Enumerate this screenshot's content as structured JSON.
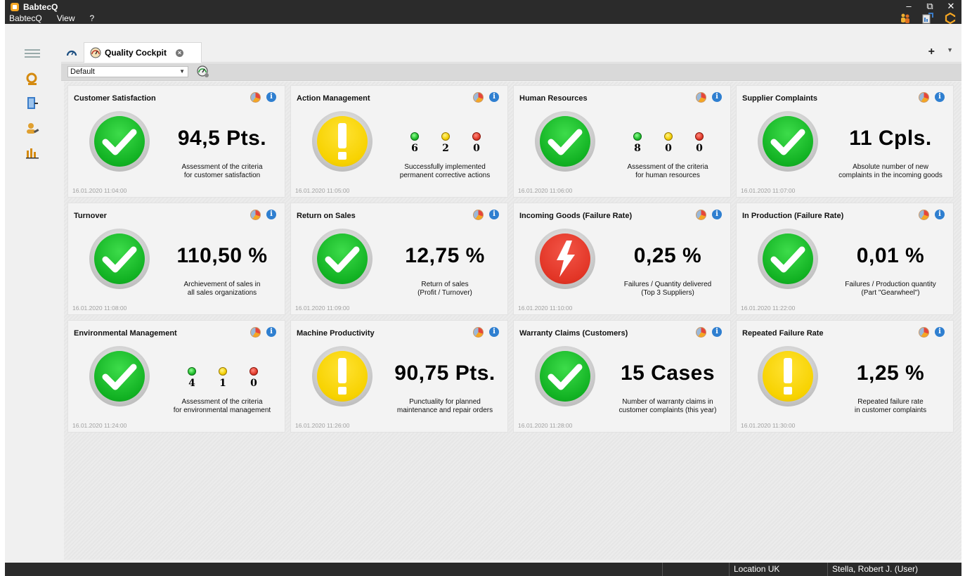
{
  "app": {
    "title": "BabtecQ"
  },
  "menu": [
    {
      "label": "BabtecQ"
    },
    {
      "label": "View"
    },
    {
      "label": "?"
    }
  ],
  "window_controls": {
    "minimize": "–",
    "restore": "⧉",
    "close": "✕"
  },
  "tabs": {
    "active_label": "Quality Cockpit"
  },
  "toolbar": {
    "select_value": "Default"
  },
  "tiles": [
    {
      "title": "Customer Satisfaction",
      "status": "ok",
      "kpi": "94,5 Pts.",
      "desc": [
        "Assessment of the criteria",
        "for customer satisfaction"
      ],
      "timestamp": "16.01.2020 11:04:00"
    },
    {
      "title": "Action Management",
      "status": "warn",
      "lights": [
        6,
        2,
        0
      ],
      "desc": [
        "Successfully implemented",
        "permanent corrective actions"
      ],
      "timestamp": "16.01.2020 11:05:00"
    },
    {
      "title": "Human Resources",
      "status": "ok",
      "lights": [
        8,
        0,
        0
      ],
      "desc": [
        "Assessment of the criteria",
        "for human resources"
      ],
      "timestamp": "16.01.2020 11:06:00"
    },
    {
      "title": "Supplier Complaints",
      "status": "ok",
      "kpi": "11 Cpls.",
      "desc": [
        "Absolute number of new",
        "complaints in the incoming goods"
      ],
      "timestamp": "16.01.2020 11:07:00"
    },
    {
      "title": "Turnover",
      "status": "ok",
      "kpi": "110,50 %",
      "desc": [
        "Archievement of sales in",
        "all sales organizations"
      ],
      "timestamp": "16.01.2020 11:08:00"
    },
    {
      "title": "Return on Sales",
      "status": "ok",
      "kpi": "12,75 %",
      "desc": [
        "Return of sales",
        "(Profit / Turnover)"
      ],
      "timestamp": "16.01.2020 11:09:00"
    },
    {
      "title": "Incoming Goods (Failure Rate)",
      "status": "error",
      "kpi": "0,25 %",
      "desc": [
        "Failures / Quantity delivered",
        "(Top 3 Suppliers)"
      ],
      "timestamp": "16.01.2020 11:10:00"
    },
    {
      "title": "In Production (Failure Rate)",
      "status": "ok",
      "kpi": "0,01 %",
      "desc": [
        "Failures / Production quantity",
        "(Part \"Gearwheel\")"
      ],
      "timestamp": "16.01.2020 11:22:00"
    },
    {
      "title": "Environmental Management",
      "status": "ok",
      "lights": [
        4,
        1,
        0
      ],
      "desc": [
        "Assessment of the criteria",
        "for environmental management"
      ],
      "timestamp": "16.01.2020 11:24:00"
    },
    {
      "title": "Machine Productivity",
      "status": "warn",
      "kpi": "90,75 Pts.",
      "desc": [
        "Punctuality for planned",
        "maintenance and repair orders"
      ],
      "timestamp": "16.01.2020 11:26:00"
    },
    {
      "title": "Warranty Claims (Customers)",
      "status": "ok",
      "kpi": "15 Cases",
      "desc": [
        "Number of warranty claims in",
        "customer complaints (this year)"
      ],
      "timestamp": "16.01.2020 11:28:00"
    },
    {
      "title": "Repeated Failure Rate",
      "status": "warn",
      "kpi": "1,25 %",
      "desc": [
        "Repeated failure rate",
        "in customer complaints"
      ],
      "timestamp": "16.01.2020 11:30:00"
    }
  ],
  "statusbar": {
    "location": "Location UK",
    "user": "Stella, Robert J. (User)"
  },
  "colors": {
    "ok": "#12b223",
    "warn": "#f7d200",
    "error": "#e23526",
    "titlebar": "#2b2b2b"
  },
  "icons": {
    "tile_chart": "pie-chart-icon",
    "tile_info": "info-icon",
    "sidebar": [
      "quality-search-icon",
      "document-exit-icon",
      "user-edit-icon",
      "bar-chart-icon"
    ],
    "top": [
      "users-icon",
      "export-icon",
      "babtec-logo-icon"
    ]
  }
}
